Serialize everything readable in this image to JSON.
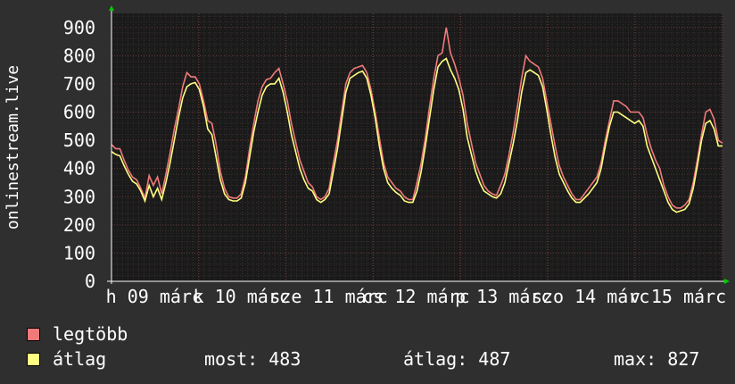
{
  "chart_data": {
    "type": "line",
    "ylabel": "onlinestream.live",
    "ylim": [
      0,
      950
    ],
    "y_ticks": [
      "0",
      "100",
      "200",
      "300",
      "400",
      "500",
      "600",
      "700",
      "800",
      "900"
    ],
    "x_tick_labels": [
      "h 09 márc",
      "k 10 márc",
      "sze 11 márc",
      "cs 12 márc",
      "p 13 márc",
      "szo 14 márc",
      "v 15 márc"
    ],
    "grid": true,
    "colors": {
      "legtobb": "#f07a7a",
      "atlag": "#ffff80",
      "plot_bg": "#1a1a1a",
      "grid": "#5a3a3a"
    },
    "series": [
      {
        "name": "legtöbb",
        "values": [
          485,
          470,
          470,
          430,
          395,
          370,
          360,
          330,
          295,
          375,
          340,
          370,
          310,
          380,
          455,
          540,
          610,
          690,
          740,
          725,
          725,
          700,
          640,
          570,
          560,
          485,
          390,
          330,
          300,
          295,
          295,
          310,
          370,
          470,
          560,
          640,
          690,
          715,
          720,
          740,
          755,
          700,
          640,
          560,
          495,
          430,
          390,
          350,
          335,
          300,
          290,
          300,
          330,
          420,
          500,
          600,
          700,
          740,
          755,
          760,
          765,
          740,
          680,
          600,
          510,
          420,
          370,
          350,
          330,
          320,
          300,
          290,
          290,
          350,
          420,
          510,
          620,
          720,
          800,
          810,
          900,
          810,
          770,
          720,
          660,
          560,
          490,
          420,
          380,
          340,
          320,
          310,
          305,
          340,
          380,
          450,
          530,
          620,
          720,
          800,
          780,
          770,
          760,
          720,
          640,
          560,
          480,
          410,
          370,
          340,
          310,
          290,
          290,
          310,
          330,
          350,
          370,
          420,
          500,
          570,
          640,
          640,
          630,
          620,
          600,
          600,
          600,
          580,
          520,
          470,
          430,
          400,
          340,
          300,
          270,
          260,
          260,
          270,
          290,
          350,
          430,
          520,
          600,
          610,
          575,
          500,
          490
        ]
      },
      {
        "name": "átlag",
        "values": [
          460,
          450,
          445,
          410,
          380,
          355,
          345,
          320,
          285,
          340,
          300,
          330,
          290,
          350,
          420,
          500,
          580,
          650,
          690,
          700,
          705,
          680,
          620,
          540,
          520,
          440,
          360,
          310,
          290,
          285,
          285,
          295,
          350,
          440,
          530,
          600,
          660,
          690,
          700,
          700,
          720,
          670,
          600,
          520,
          460,
          400,
          360,
          330,
          320,
          290,
          280,
          290,
          310,
          390,
          470,
          570,
          670,
          720,
          730,
          740,
          745,
          720,
          660,
          580,
          480,
          400,
          350,
          330,
          315,
          305,
          285,
          280,
          280,
          320,
          390,
          480,
          580,
          680,
          760,
          780,
          790,
          750,
          720,
          680,
          610,
          510,
          450,
          390,
          350,
          320,
          310,
          300,
          295,
          310,
          350,
          420,
          490,
          570,
          670,
          740,
          750,
          740,
          730,
          690,
          610,
          520,
          440,
          380,
          350,
          320,
          295,
          280,
          280,
          295,
          310,
          330,
          350,
          400,
          480,
          550,
          600,
          600,
          590,
          580,
          570,
          560,
          570,
          550,
          480,
          440,
          400,
          360,
          320,
          280,
          255,
          245,
          250,
          255,
          275,
          330,
          410,
          500,
          560,
          570,
          540,
          480,
          480
        ]
      }
    ]
  },
  "legend": [
    {
      "label": "legtöbb",
      "color": "#f07a7a"
    },
    {
      "label": "átlag",
      "color": "#ffff80"
    }
  ],
  "stats": {
    "most": "most: 483",
    "atlag": "átlag: 487",
    "max": "max: 827"
  }
}
